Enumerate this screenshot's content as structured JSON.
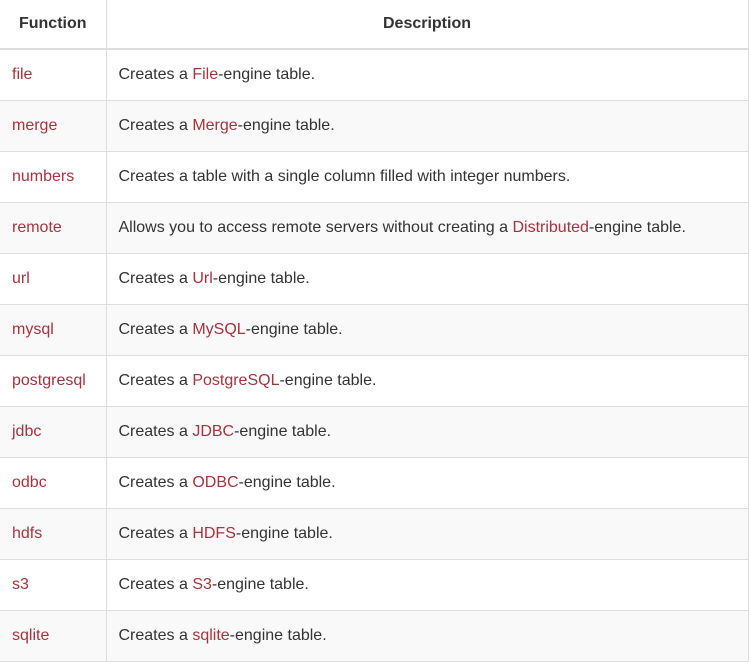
{
  "table": {
    "headers": [
      "Function",
      "Description"
    ],
    "rows": [
      {
        "fn": "file",
        "pre": "Creates a ",
        "link": "File",
        "post": "-engine table."
      },
      {
        "fn": "merge",
        "pre": "Creates a ",
        "link": "Merge",
        "post": "-engine table."
      },
      {
        "fn": "numbers",
        "pre": "Creates a table with a single column filled with integer numbers.",
        "link": "",
        "post": ""
      },
      {
        "fn": "remote",
        "pre": "Allows you to access remote servers without creating a ",
        "link": "Distributed",
        "post": "-engine table."
      },
      {
        "fn": "url",
        "pre": "Creates a ",
        "link": "Url",
        "post": "-engine table."
      },
      {
        "fn": "mysql",
        "pre": "Creates a ",
        "link": "MySQL",
        "post": "-engine table."
      },
      {
        "fn": "postgresql",
        "pre": "Creates a ",
        "link": "PostgreSQL",
        "post": "-engine table."
      },
      {
        "fn": "jdbc",
        "pre": "Creates a ",
        "link": "JDBC",
        "post": "-engine table."
      },
      {
        "fn": "odbc",
        "pre": "Creates a ",
        "link": "ODBC",
        "post": "-engine table."
      },
      {
        "fn": "hdfs",
        "pre": "Creates a ",
        "link": "HDFS",
        "post": "-engine table."
      },
      {
        "fn": "s3",
        "pre": "Creates a ",
        "link": "S3",
        "post": "-engine table."
      },
      {
        "fn": "sqlite",
        "pre": "Creates a ",
        "link": "sqlite",
        "post": "-engine table."
      }
    ]
  },
  "colors": {
    "link": "#a8323d",
    "text": "#333333",
    "stripe": "#f9f9f9",
    "border": "#dddddd"
  }
}
